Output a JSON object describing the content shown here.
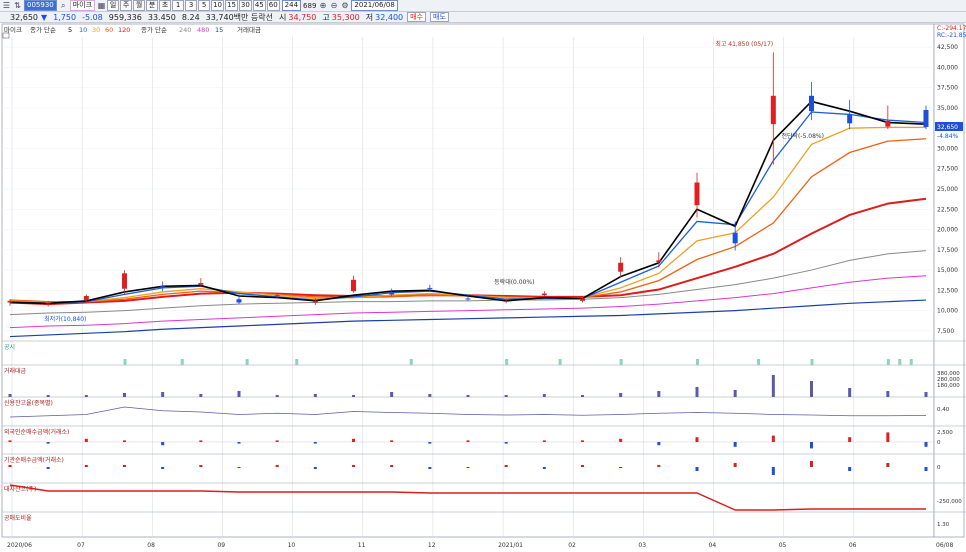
{
  "toolbar": {
    "code": "005930",
    "name": "마이크",
    "period_buttons": [
      "1",
      "3",
      "5",
      "10",
      "15",
      "30",
      "45",
      "60"
    ],
    "count": "244",
    "total": "689",
    "date": "2021/06/08"
  },
  "quote": {
    "price": "32,650",
    "change": "1,750",
    "change_pct": "-5.08",
    "volume": "959,336",
    "vol_ratio": "33.450",
    "rate": "8.24",
    "amount": "33,740백만 등락선",
    "open_label": "시",
    "open": "34,750",
    "high_label": "고",
    "high": "35,300",
    "low_label": "저",
    "low": "32,400",
    "buy_label": "매수",
    "sell_label": "매도"
  },
  "legend": {
    "main_tag": "마이크",
    "ma1_title": "종가 단순",
    "ma1_periods": [
      "5",
      "10",
      "30",
      "60",
      "120"
    ],
    "ma2_title": "종가 단순",
    "ma2_periods": [
      "240",
      "480",
      "15"
    ],
    "vol_title": "거래대금"
  },
  "right_labels": {
    "top1": "C:-294.17",
    "top2": "RC:-21.85"
  },
  "annotations": {
    "high": "최고 41,850 (05/17)",
    "low": "최저가(10,840)",
    "mid_a": "등락대(0.00%)",
    "mid_b": "전단락(-5.08%)"
  },
  "current_price_label": "32,650",
  "current_pct_label": "-4.84%",
  "pane_titles": [
    "공시",
    "거래대금",
    "신용잔고율(종목별)",
    "외국인순매수금액(거래소)",
    "기관순매수금액(거래소)",
    "대차잔고(주)",
    "공매도비율"
  ],
  "pane_ticks": {
    "vol": [
      "380,000",
      "280,000",
      "180,000"
    ],
    "credit": [
      "0.40"
    ],
    "foreign": [
      "2,500",
      "0"
    ],
    "inst": [
      "0"
    ],
    "loan": [
      "-250,000"
    ],
    "short": [
      "1.30"
    ]
  },
  "colors": {
    "up": "#e02020",
    "down": "#1e4fd8",
    "ma5": "#000000",
    "ma10": "#1c5fd4",
    "ma30": "#f0a020",
    "ma60": "#f06010",
    "ma120": "#dd1c1c",
    "ma240": "#888888",
    "ma480": "#dd36c8",
    "ma_long": "#1c3fa6",
    "grid": "#d8dce6"
  },
  "chart_data": {
    "type": "candlestick",
    "xlabel": "",
    "ylabel": "",
    "ylim": [
      6250,
      43750
    ],
    "yticks": [
      7500,
      10000,
      12500,
      15000,
      17500,
      20000,
      22500,
      25000,
      27500,
      30000,
      32500,
      35000,
      37500,
      40000,
      42500
    ],
    "ytick_labels": [
      "7,500",
      "10,000",
      "12,500",
      "15,000",
      "17,500",
      "20,000",
      "22,500",
      "25,000",
      "27,500",
      "30,000",
      "32,500",
      "35,000",
      "37,500",
      "40,000",
      "42,500"
    ],
    "month_labels": [
      "2020/06",
      "07",
      "08",
      "09",
      "10",
      "11",
      "12",
      "2021/01",
      "02",
      "03",
      "04",
      "05",
      "06",
      "06/08"
    ],
    "series": [
      {
        "name": "close",
        "x": [
          0,
          10,
          20,
          30,
          40,
          50,
          60,
          70,
          80,
          90,
          100,
          110,
          120,
          130,
          140,
          150,
          160,
          170,
          180,
          190,
          200,
          210,
          220,
          230,
          240
        ],
        "values": [
          11000,
          10900,
          11300,
          12700,
          13000,
          13200,
          11400,
          11800,
          11000,
          12400,
          12300,
          12800,
          11500,
          11100,
          11900,
          11200,
          14800,
          16000,
          23000,
          19600,
          33000,
          36500,
          34200,
          32700,
          32650
        ]
      }
    ],
    "candles": [
      [
        "O",
        11000,
        11400,
        10600,
        11200
      ],
      [
        "O",
        10900,
        11200,
        10500,
        11000
      ],
      [
        "O",
        11300,
        12000,
        11100,
        11800
      ],
      [
        "O",
        12700,
        15000,
        12000,
        14600
      ],
      [
        "O",
        13000,
        13600,
        12400,
        12800
      ],
      [
        "O",
        13200,
        14000,
        12900,
        13400
      ],
      [
        "O",
        11400,
        12000,
        10800,
        11000
      ],
      [
        "O",
        11800,
        12200,
        11500,
        11900
      ],
      [
        "O",
        11000,
        11500,
        10700,
        11200
      ],
      [
        "O",
        12400,
        14300,
        12200,
        13800
      ],
      [
        "O",
        12300,
        12700,
        11800,
        12000
      ],
      [
        "O",
        12800,
        13200,
        12400,
        12700
      ],
      [
        "O",
        11500,
        11900,
        11200,
        11400
      ],
      [
        "O",
        11100,
        11500,
        10900,
        11200
      ],
      [
        "O",
        11900,
        12400,
        11700,
        12100
      ],
      [
        "O",
        11200,
        11700,
        11000,
        11500
      ],
      [
        "O",
        14800,
        16600,
        14100,
        15900
      ],
      [
        "O",
        16000,
        17200,
        15300,
        16200
      ],
      [
        "O",
        23000,
        27000,
        21500,
        25800
      ],
      [
        "O",
        19600,
        21000,
        17400,
        18300
      ],
      [
        "O",
        33000,
        41850,
        28000,
        36500
      ],
      [
        "O",
        36500,
        38200,
        33500,
        34600
      ],
      [
        "O",
        34200,
        36000,
        32400,
        33100
      ],
      [
        "O",
        32700,
        35300,
        32400,
        33400
      ],
      [
        "O",
        34750,
        35300,
        32400,
        32650
      ]
    ],
    "ma5": [
      11000,
      10900,
      11200,
      12300,
      13000,
      13100,
      11800,
      11600,
      11200,
      11900,
      12400,
      12500,
      11800,
      11200,
      11600,
      11500,
      14200,
      15900,
      22500,
      20400,
      31000,
      35800,
      34600,
      33200,
      33000
    ],
    "ma10": [
      11100,
      10900,
      11100,
      12000,
      12800,
      13000,
      12100,
      11700,
      11300,
      11700,
      12200,
      12400,
      11900,
      11400,
      11500,
      11500,
      13500,
      15500,
      21000,
      20600,
      28500,
      34500,
      34200,
      33500,
      33200
    ],
    "ma30": [
      11200,
      11000,
      11100,
      11600,
      12300,
      12700,
      12300,
      11900,
      11500,
      11600,
      11900,
      12100,
      11900,
      11600,
      11500,
      11600,
      12800,
      14600,
      18600,
      19600,
      24000,
      30500,
      32500,
      32600,
      32600
    ],
    "ma60": [
      11300,
      11100,
      11100,
      11400,
      12000,
      12400,
      12200,
      12000,
      11700,
      11600,
      11700,
      11900,
      11800,
      11700,
      11600,
      11600,
      12300,
      13700,
      16300,
      17900,
      20800,
      26500,
      29500,
      30900,
      31200
    ],
    "ma120": [
      11000,
      10800,
      11000,
      11200,
      11700,
      12100,
      12200,
      12100,
      11900,
      11800,
      11800,
      11900,
      11900,
      11800,
      11700,
      11700,
      11900,
      12600,
      14000,
      15400,
      17000,
      19500,
      21800,
      23200,
      23800
    ],
    "ma240": [
      9500,
      9700,
      9800,
      10000,
      10300,
      10600,
      10800,
      10900,
      11000,
      11100,
      11100,
      11200,
      11200,
      11300,
      11300,
      11400,
      11600,
      12000,
      12600,
      13200,
      14000,
      15000,
      16200,
      17000,
      17400
    ],
    "ma480": [
      7900,
      8100,
      8200,
      8400,
      8700,
      8900,
      9100,
      9300,
      9500,
      9700,
      9800,
      9900,
      10000,
      10100,
      10200,
      10300,
      10500,
      10800,
      11200,
      11600,
      12100,
      12800,
      13500,
      14000,
      14300
    ],
    "ma_long": [
      6800,
      7000,
      7200,
      7400,
      7700,
      7900,
      8100,
      8300,
      8500,
      8700,
      8800,
      8900,
      9000,
      9100,
      9200,
      9300,
      9400,
      9600,
      9800,
      10000,
      10300,
      10600,
      10900,
      11100,
      11300
    ]
  }
}
